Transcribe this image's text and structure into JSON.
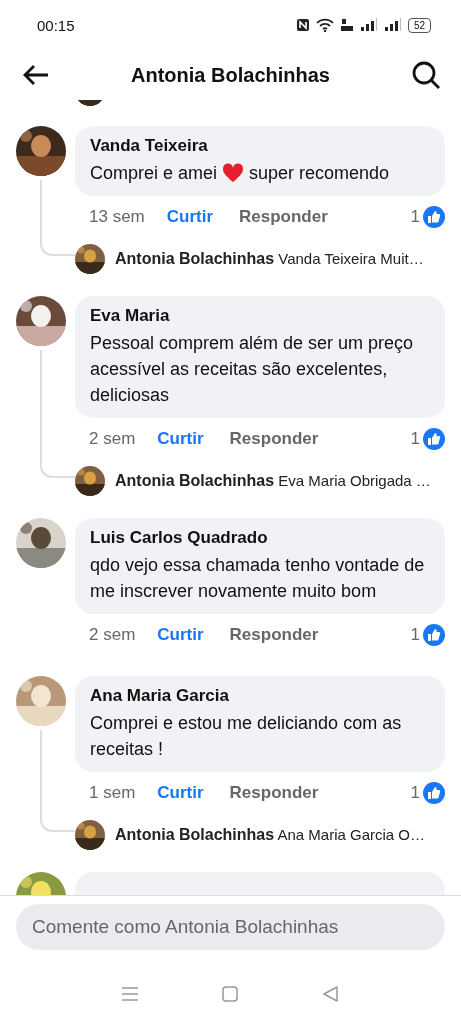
{
  "status_bar": {
    "time": "00:15",
    "battery": "52"
  },
  "header": {
    "title": "Antonia Bolachinhas"
  },
  "comments": [
    {
      "author": "Vanda Teixeira",
      "text": "Comprei e amei",
      "heart": true,
      "text_after": "super recomendo",
      "time": "13 sem",
      "like": "Curtir",
      "reply": "Responder",
      "reactions": "1",
      "replies": [
        {
          "author": "Antonia Bolachinhas",
          "text": "Vanda Teixeira Muit…"
        }
      ]
    },
    {
      "author": "Eva Maria",
      "text": "Pessoal comprem além de ser um preço acessível as receitas são excelentes, deliciosas",
      "time": "2 sem",
      "like": "Curtir",
      "reply": "Responder",
      "reactions": "1",
      "replies": [
        {
          "author": "Antonia Bolachinhas",
          "text": "Eva Maria Obrigada …"
        }
      ]
    },
    {
      "author": "Luis Carlos Quadrado",
      "text": "qdo vejo essa chamada tenho vontade de me inscrever novamente muito bom",
      "time": "2 sem",
      "like": "Curtir",
      "reply": "Responder",
      "reactions": "1"
    },
    {
      "author": "Ana Maria Garcia",
      "text": "Comprei e estou me deliciando com as receitas !",
      "time": "1 sem",
      "like": "Curtir",
      "reply": "Responder",
      "reactions": "1",
      "replies": [
        {
          "author": "Antonia Bolachinhas",
          "text": "Ana Maria Garcia O…"
        }
      ]
    }
  ],
  "composer": {
    "placeholder": "Comente como Antonia Bolachinhas"
  }
}
